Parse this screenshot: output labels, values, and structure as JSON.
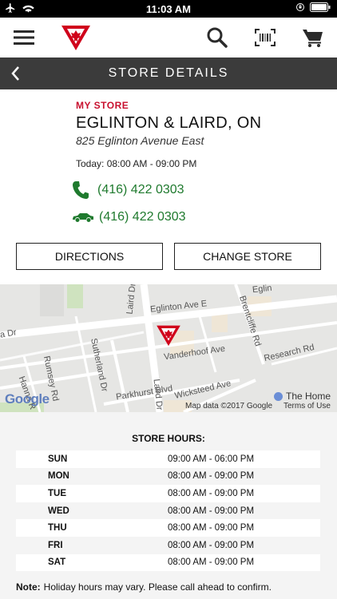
{
  "status": {
    "time": "11:03 AM"
  },
  "header": {
    "title": "STORE DETAILS"
  },
  "store": {
    "label": "MY STORE",
    "name": "EGLINTON & LAIRD, ON",
    "address": "825 Eglinton Avenue East",
    "today_hours": "Today: 08:00 AM - 09:00 PM",
    "phone1": "(416) 422 0303",
    "phone2": "(416) 422 0303"
  },
  "buttons": {
    "directions": "DIRECTIONS",
    "change_store": "CHANGE STORE"
  },
  "map": {
    "streets": {
      "eglinton_ave_e": "Eglinton Ave E",
      "eglinton_top": "Eglin",
      "laird_dr_top": "Laird Dr",
      "laird_dr_bottom": "Laird Dr",
      "vanderhoof": "Vanderhoof Ave",
      "research_rd": "Research Rd",
      "brentcliffe": "Brentcliffe Rd",
      "sutherland": "Sutherland Dr",
      "rumsey": "Rumsey Rd",
      "hanna": "Hanna R",
      "parkhurst": "Parkhurst Blvd",
      "wicksteed": "Wicksteed Ave",
      "dr_left": "a Dr",
      "home": "The Home"
    },
    "google": "Google",
    "attribution": "Map data ©2017 Google",
    "terms": "Terms of Use"
  },
  "hours": {
    "title": "STORE HOURS:",
    "rows": [
      {
        "day": "SUN",
        "time": "09:00 AM - 06:00 PM"
      },
      {
        "day": "MON",
        "time": "08:00 AM - 09:00 PM"
      },
      {
        "day": "TUE",
        "time": "08:00 AM - 09:00 PM"
      },
      {
        "day": "WED",
        "time": "08:00 AM - 09:00 PM"
      },
      {
        "day": "THU",
        "time": "08:00 AM - 09:00 PM"
      },
      {
        "day": "FRI",
        "time": "08:00 AM - 09:00 PM"
      },
      {
        "day": "SAT",
        "time": "08:00 AM - 09:00 PM"
      }
    ]
  },
  "note": {
    "label": "Note:",
    "text": "Holiday hours may vary. Please call ahead to confirm."
  },
  "colors": {
    "brand_red": "#c8102e",
    "phone_green": "#1f7a2e",
    "header_dark": "#3b3b3b"
  },
  "icons": [
    "airplane-icon",
    "wifi-icon",
    "lock-rotation-icon",
    "battery-icon",
    "menu-icon",
    "logo-icon",
    "search-icon",
    "barcode-icon",
    "cart-icon",
    "back-chevron-icon",
    "phone-icon",
    "car-icon",
    "map-pin-icon"
  ]
}
